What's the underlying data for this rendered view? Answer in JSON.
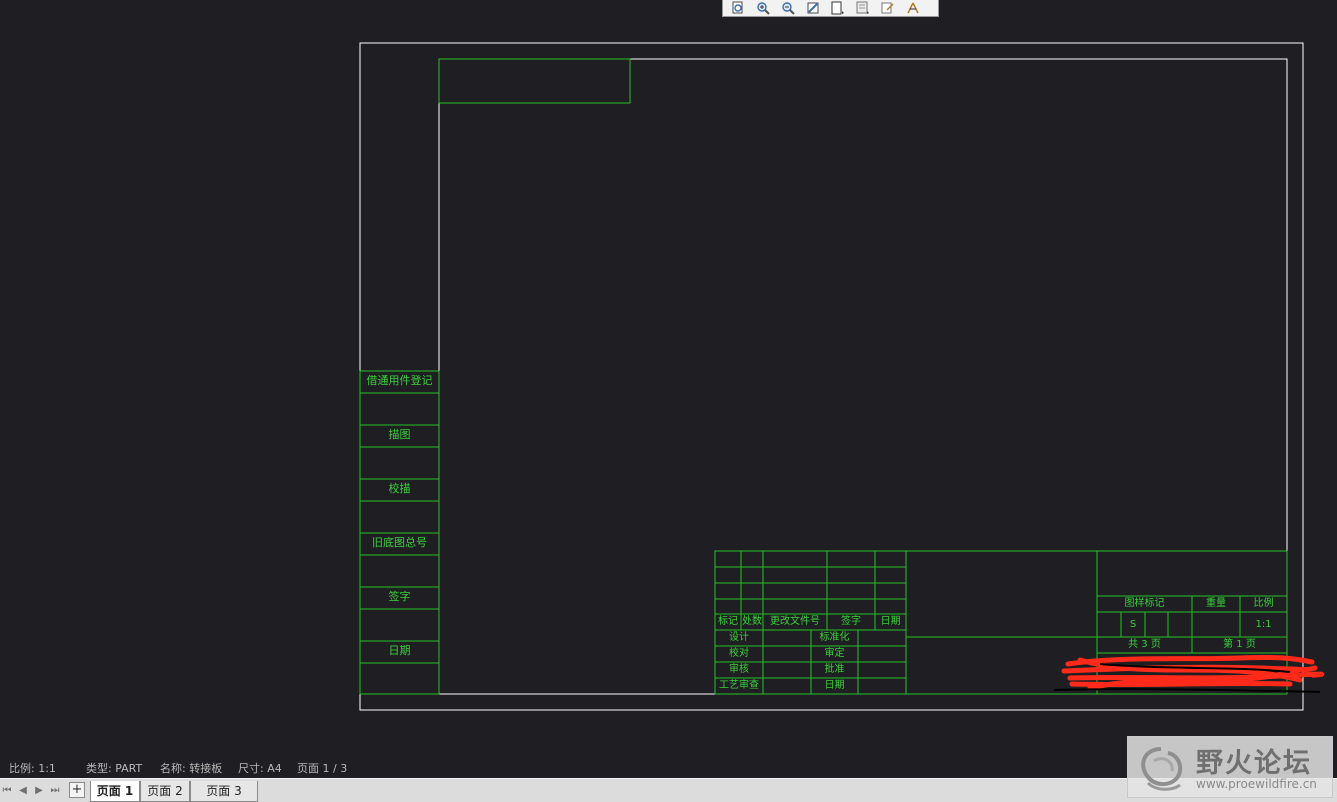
{
  "toolbar": {
    "buttons": [
      {
        "icon": "refit-icon"
      },
      {
        "icon": "zoom-in-icon"
      },
      {
        "icon": "zoom-out-icon"
      },
      {
        "icon": "repaint-icon"
      },
      {
        "icon": "view-display-icon"
      },
      {
        "icon": "layers-icon"
      },
      {
        "icon": "annotation-icon"
      },
      {
        "icon": "spin-center-icon"
      }
    ]
  },
  "colors": {
    "background": "#1f1f23",
    "sheet_border": "#ffffff",
    "table_lines": "#26c226",
    "table_text": "#39d139",
    "scribble": "#ff2a1a"
  },
  "side_table": {
    "labels": [
      "借通用件登记",
      "描图",
      "校描",
      "旧底图总号",
      "签字",
      "日期"
    ]
  },
  "title_block": {
    "revision_headers": [
      "标记",
      "处数",
      "更改文件号",
      "签字",
      "日期"
    ],
    "sign_labels": {
      "design": "设计",
      "standardize": "标准化",
      "check": "校对",
      "review": "审定",
      "audit": "审核",
      "approve": "批准",
      "process_review": "工艺审查",
      "date": "日期"
    },
    "info": {
      "drawing_mark": "图样标记",
      "weight": "重量",
      "scale": "比例",
      "mark_value": "S",
      "scale_value": "1:1",
      "total_sheets": "共 3 页",
      "sheet_number": "第 1 页"
    }
  },
  "status": {
    "scale": "比例: 1:1",
    "type": "类型: PART",
    "name": "名称: 转接板",
    "size": "尺寸: A4",
    "page": "页面 1  / 3"
  },
  "tabs": {
    "nav": {
      "first": "⏮",
      "prev": "◀",
      "next": "▶",
      "last": "⏭"
    },
    "add": "+",
    "sheets": [
      {
        "label": "页面 1",
        "active": true
      },
      {
        "label": "页面 2",
        "active": false
      },
      {
        "label": "页面 3",
        "active": false
      }
    ]
  },
  "watermark": {
    "title": "野火论坛",
    "url": "www.proewildfire.cn"
  }
}
